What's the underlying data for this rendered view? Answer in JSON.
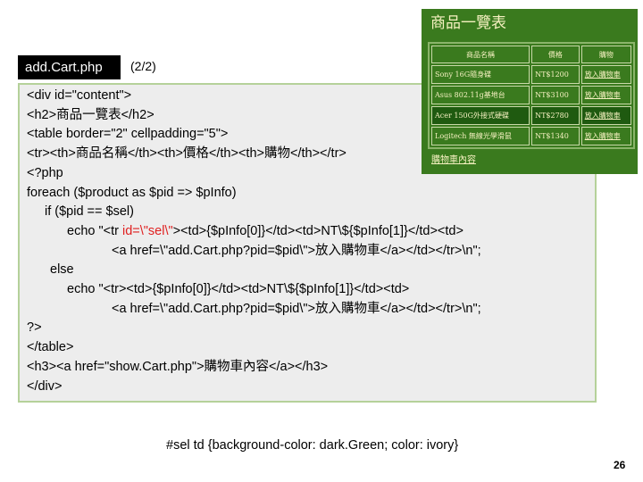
{
  "file_name": "add.Cart.php",
  "page_indicator": "(2/2)",
  "code": {
    "l1": "<div id=\"content\">",
    "l2": "<h2>商品一覽表</h2>",
    "l3": "<table border=\"2\" cellpadding=\"5\">",
    "l4": "<tr><th>商品名稱</th><th>價格</th><th>購物</th></tr>",
    "l5": "<?php",
    "l6": "foreach ($product as $pid => $pInfo)",
    "l7": "if ($pid == $sel)",
    "l8_pre": "echo \"<tr ",
    "l8_hl": "id=\\\"sel\\\"",
    "l8_post": "><td>{$pInfo[0]}</td><td>NT\\${$pInfo[1]}</td><td>",
    "l9": "<a href=\\\"add.Cart.php?pid=$pid\\\">放入購物車</a></td></tr>\\n\";",
    "l10": "else",
    "l11": "echo \"<tr><td>{$pInfo[0]}</td><td>NT\\${$pInfo[1]}</td><td>",
    "l12": "<a href=\\\"add.Cart.php?pid=$pid\\\">放入購物車</a></td></tr>\\n\";",
    "l13": "?>",
    "l14": "</table>",
    "l15": "<h3><a href=\"show.Cart.php\">購物車內容</a></h3>",
    "l16": "</div>"
  },
  "preview": {
    "title": "商品一覽表",
    "headers": [
      "商品名稱",
      "價格",
      "購物"
    ],
    "rows": [
      {
        "name": "Sony 16G隨身碟",
        "price": "NT$1200",
        "action": "放入購物車"
      },
      {
        "name": "Asus 802.11g基地台",
        "price": "NT$3100",
        "action": "放入購物車"
      },
      {
        "name": "Acer 150G外接式硬碟",
        "price": "NT$2780",
        "action": "放入購物車"
      },
      {
        "name": "Logitech 無線光學滑鼠",
        "price": "NT$1340",
        "action": "放入購物車"
      }
    ],
    "cart_link": "購物車內容"
  },
  "css_note": "#sel td {background-color: dark.Green; color: ivory}",
  "page_number": "26",
  "colors": {
    "preview_bg": "#3a7a1e",
    "selected_row": "#1f5a10",
    "highlight_text": "#e02020",
    "code_box_border": "#b5d19a"
  }
}
